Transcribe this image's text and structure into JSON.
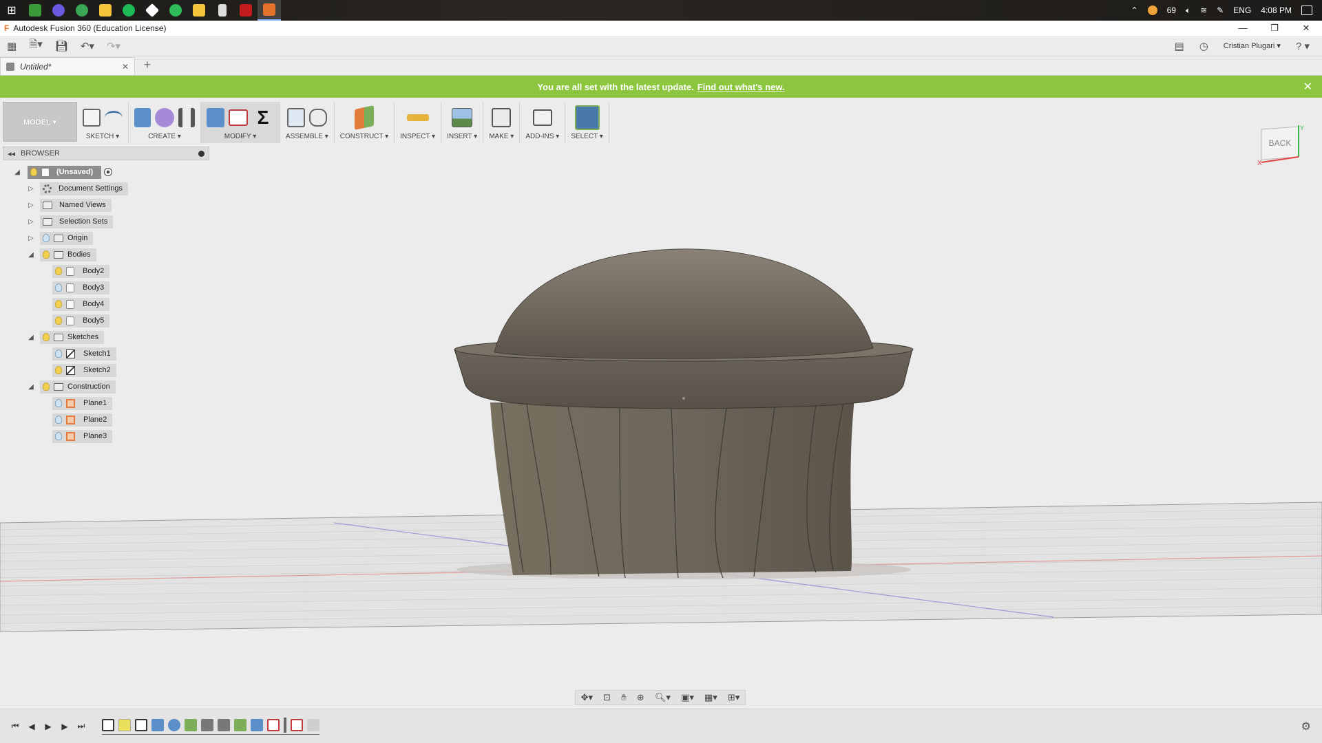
{
  "taskbar": {
    "apps": [
      {
        "icon": "windows-start-icon",
        "color": "#ffffff"
      },
      {
        "icon": "green-app-icon",
        "color": "#3a9a3a"
      },
      {
        "icon": "firefox-icon",
        "color": "#6a5ae0"
      },
      {
        "icon": "chrome-icon",
        "color": "#3aa757"
      },
      {
        "icon": "file-explorer-icon",
        "color": "#f3c33a"
      },
      {
        "icon": "spotify-icon",
        "color": "#1db954"
      },
      {
        "icon": "git-icon",
        "color": "#ffffff"
      },
      {
        "icon": "green-arrow-icon",
        "color": "#2ebd59"
      },
      {
        "icon": "folder-icon",
        "color": "#f3c33a"
      },
      {
        "icon": "calculator-icon",
        "color": "#dddddd"
      },
      {
        "icon": "acrobat-icon",
        "color": "#c21d1d"
      },
      {
        "icon": "fusion360-icon",
        "color": "#e6732b"
      }
    ],
    "battery": "69",
    "language": "ENG",
    "time": "4:08 PM"
  },
  "window": {
    "title": "Autodesk Fusion 360 (Education License)"
  },
  "app_toolbar": {
    "user": "Cristian Plugari ▾",
    "help": "? ▾"
  },
  "document_tab": {
    "name": "Untitled*"
  },
  "banner": {
    "message": "You are all set with the latest update.",
    "link": "Find out what's new."
  },
  "ribbon": {
    "mode": "MODEL ▾",
    "groups": [
      {
        "label": "SKETCH ▾"
      },
      {
        "label": "CREATE ▾"
      },
      {
        "label": "MODIFY ▾"
      },
      {
        "label": "ASSEMBLE ▾"
      },
      {
        "label": "CONSTRUCT ▾"
      },
      {
        "label": "INSPECT ▾"
      },
      {
        "label": "INSERT ▾"
      },
      {
        "label": "MAKE ▾"
      },
      {
        "label": "ADD-INS ▾"
      },
      {
        "label": "SELECT ▾"
      }
    ]
  },
  "browser": {
    "title": "BROWSER",
    "root": "(Unsaved)",
    "items": [
      {
        "label": "Document Settings"
      },
      {
        "label": "Named Views"
      },
      {
        "label": "Selection Sets"
      },
      {
        "label": "Origin"
      },
      {
        "label": "Bodies"
      },
      {
        "label": "Body2"
      },
      {
        "label": "Body3"
      },
      {
        "label": "Body4"
      },
      {
        "label": "Body5"
      },
      {
        "label": "Sketches"
      },
      {
        "label": "Sketch1"
      },
      {
        "label": "Sketch2"
      },
      {
        "label": "Construction"
      },
      {
        "label": "Plane1"
      },
      {
        "label": "Plane2"
      },
      {
        "label": "Plane3"
      }
    ]
  },
  "viewcube": {
    "face": "BACK",
    "x_label": "X",
    "y_label": "Y"
  },
  "colors": {
    "banner": "#8cc63f",
    "accent": "#e6732b",
    "select_blue": "#4a78a8"
  }
}
